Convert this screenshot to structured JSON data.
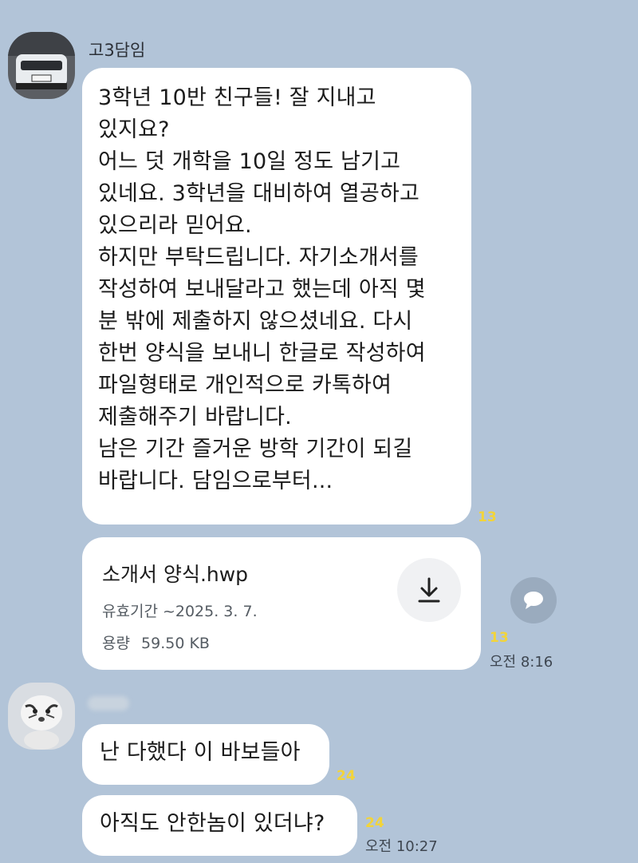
{
  "messages": [
    {
      "sender": "고3담임",
      "avatar": "car-photo-avatar",
      "text": "3학년 10반 친구들! 잘 지내고\n있지요?\n어느 덧 개학을 10일 정도 남기고\n있네요. 3학년을 대비하여 열공하고\n있으리라 믿어요.\n하지만 부탁드립니다. 자기소개서를\n작성하여 보내달라고 했는데 아직 몇\n분 밖에 제출하지 않으셨네요. 다시\n한번 양식을 보내니 한글로 작성하여\n파일형태로 개인적으로 카톡하여\n제출해주기 바랍니다.\n남은 기간 즐거운 방학 기간이 되길\n바랍니다. 담임으로부터...",
      "unread": "13"
    },
    {
      "file": {
        "name": "소개서 양식.hwp",
        "expiry": "유효기간 ~2025. 3. 7.",
        "size_label": "용량",
        "size": "59.50 KB"
      },
      "unread": "13",
      "time": "오전 8:16"
    },
    {
      "sender_hidden": true,
      "avatar": "tiger-plush-avatar",
      "text": "난 다했다 이 바보들아",
      "unread": "24"
    },
    {
      "text": "아직도 안한놈이 있더냐?",
      "unread": "24",
      "time": "오전 10:27"
    }
  ],
  "colors": {
    "background": "#b2c4d8",
    "bubble": "#ffffff",
    "unread": "#f2d43a"
  },
  "icons": [
    "download-icon",
    "share-bubble-icon"
  ]
}
